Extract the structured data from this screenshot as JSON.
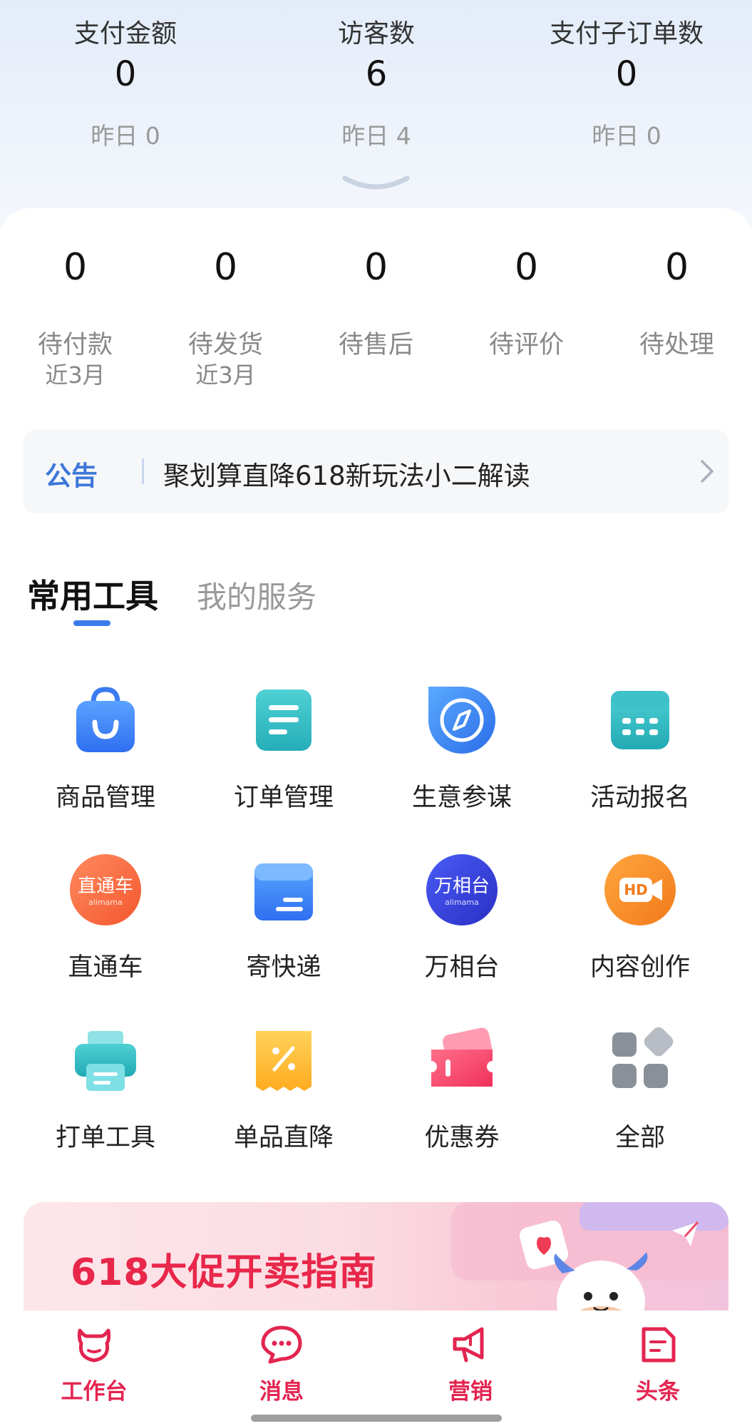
{
  "stats": [
    {
      "label": "支付金额",
      "value": "0",
      "yesterday": "昨日 0"
    },
    {
      "label": "访客数",
      "value": "6",
      "yesterday": "昨日 4"
    },
    {
      "label": "支付子订单数",
      "value": "0",
      "yesterday": "昨日 0"
    }
  ],
  "orders": [
    {
      "num": "0",
      "label": "待付款",
      "sub": "近3月"
    },
    {
      "num": "0",
      "label": "待发货",
      "sub": "近3月"
    },
    {
      "num": "0",
      "label": "待售后",
      "sub": ""
    },
    {
      "num": "0",
      "label": "待评价",
      "sub": ""
    },
    {
      "num": "0",
      "label": "待处理",
      "sub": ""
    }
  ],
  "notice": {
    "tag": "公告",
    "text": "聚划算直降618新玩法小二解读"
  },
  "tabs": {
    "active": "常用工具",
    "inactive": "我的服务"
  },
  "tools": [
    {
      "name": "商品管理",
      "icon": "shopping-bag-icon"
    },
    {
      "name": "订单管理",
      "icon": "order-list-icon"
    },
    {
      "name": "生意参谋",
      "icon": "compass-icon"
    },
    {
      "name": "活动报名",
      "icon": "calendar-icon"
    },
    {
      "name": "直通车",
      "icon": "ztc-logo-icon",
      "logo_text": "直通车",
      "logo_sub": "alimama"
    },
    {
      "name": "寄快递",
      "icon": "parcel-box-icon"
    },
    {
      "name": "万相台",
      "icon": "wxt-logo-icon",
      "logo_text": "万相台",
      "logo_sub": "alimama"
    },
    {
      "name": "内容创作",
      "icon": "hd-video-icon",
      "logo_text": "HD"
    },
    {
      "name": "打单工具",
      "icon": "printer-icon"
    },
    {
      "name": "单品直降",
      "icon": "discount-tag-icon"
    },
    {
      "name": "优惠券",
      "icon": "coupon-icon"
    },
    {
      "name": "全部",
      "icon": "all-apps-icon"
    }
  ],
  "banner": {
    "title": "618大促开卖指南"
  },
  "nav": [
    {
      "label": "工作台",
      "icon": "cow-head-icon"
    },
    {
      "label": "消息",
      "icon": "chat-bubble-icon"
    },
    {
      "label": "营销",
      "icon": "megaphone-icon"
    },
    {
      "label": "头条",
      "icon": "news-icon"
    }
  ],
  "colors": {
    "accent": "#3a7bea",
    "nav_active": "#e32550",
    "banner_title": "#e8274a"
  }
}
